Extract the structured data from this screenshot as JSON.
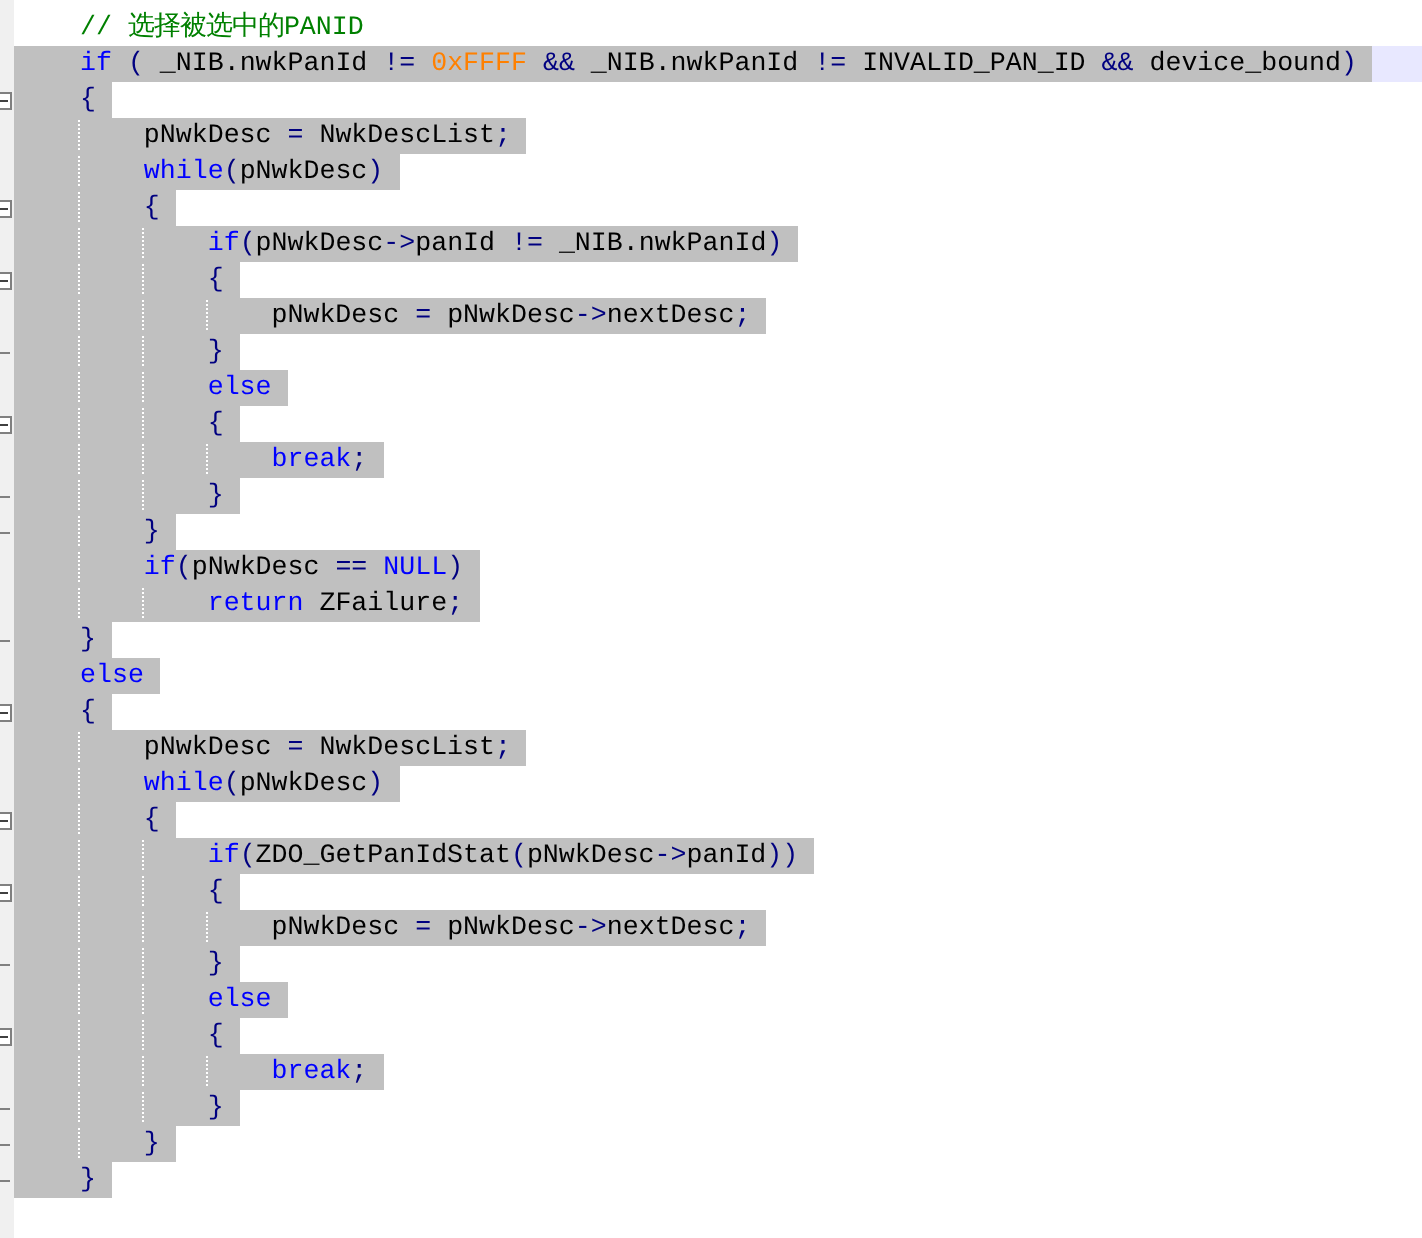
{
  "editor": {
    "lines": [
      {
        "kind": "plain",
        "selected": false,
        "current": false,
        "tokens": [
          {
            "comment": "// 选择被选中的PANID"
          }
        ]
      },
      {
        "kind": "plain",
        "selected": true,
        "current": true,
        "tokens": [
          {
            "keyword": "if"
          },
          {
            "operator": " ( "
          },
          {
            "identifier": "_NIB.nwkPanId "
          },
          {
            "operator": "!= "
          },
          {
            "number": "0xFFFF"
          },
          {
            "operator": " && "
          },
          {
            "identifier": "_NIB.nwkPanId "
          },
          {
            "operator": "!= "
          },
          {
            "identifier": "INVALID_PAN_ID "
          },
          {
            "operator": "&& "
          },
          {
            "identifier": "device_bound"
          },
          {
            "operator": ")"
          }
        ]
      },
      {
        "kind": "block-start",
        "selected": true,
        "current": false,
        "tokens": [
          {
            "operator": "{"
          }
        ]
      },
      {
        "kind": "plain",
        "selected": true,
        "current": false,
        "tokens": [
          {
            "identifier": "    pNwkDesc "
          },
          {
            "operator": "= "
          },
          {
            "identifier": "NwkDescList"
          },
          {
            "operator": ";"
          }
        ]
      },
      {
        "kind": "plain",
        "selected": true,
        "current": false,
        "tokens": [
          {
            "keyword": "    while"
          },
          {
            "operator": "("
          },
          {
            "identifier": "pNwkDesc"
          },
          {
            "operator": ")"
          }
        ]
      },
      {
        "kind": "block-start",
        "selected": true,
        "current": false,
        "tokens": [
          {
            "operator": "    {"
          }
        ]
      },
      {
        "kind": "plain",
        "selected": true,
        "current": false,
        "tokens": [
          {
            "keyword": "        if"
          },
          {
            "operator": "("
          },
          {
            "identifier": "pNwkDesc"
          },
          {
            "operator": "->"
          },
          {
            "identifier": "panId "
          },
          {
            "operator": "!= "
          },
          {
            "identifier": "_NIB.nwkPanId"
          },
          {
            "operator": ")"
          }
        ]
      },
      {
        "kind": "block-start",
        "selected": true,
        "current": false,
        "tokens": [
          {
            "operator": "        {"
          }
        ]
      },
      {
        "kind": "plain",
        "selected": true,
        "current": false,
        "tokens": [
          {
            "identifier": "            pNwkDesc "
          },
          {
            "operator": "= "
          },
          {
            "identifier": "pNwkDesc"
          },
          {
            "operator": "->"
          },
          {
            "identifier": "nextDesc"
          },
          {
            "operator": ";"
          }
        ]
      },
      {
        "kind": "block-end",
        "selected": true,
        "current": false,
        "tokens": [
          {
            "operator": "        }"
          }
        ]
      },
      {
        "kind": "plain",
        "selected": true,
        "current": false,
        "tokens": [
          {
            "keyword": "        else"
          }
        ]
      },
      {
        "kind": "block-start",
        "selected": true,
        "current": false,
        "tokens": [
          {
            "operator": "        {"
          }
        ]
      },
      {
        "kind": "plain",
        "selected": true,
        "current": false,
        "tokens": [
          {
            "keyword": "            break"
          },
          {
            "operator": ";"
          }
        ]
      },
      {
        "kind": "block-end",
        "selected": true,
        "current": false,
        "tokens": [
          {
            "operator": "        }"
          }
        ]
      },
      {
        "kind": "block-end",
        "selected": true,
        "current": false,
        "tokens": [
          {
            "operator": "    }"
          }
        ]
      },
      {
        "kind": "plain",
        "selected": true,
        "current": false,
        "tokens": [
          {
            "keyword": "    if"
          },
          {
            "operator": "("
          },
          {
            "identifier": "pNwkDesc "
          },
          {
            "operator": "== "
          },
          {
            "keyword": "NULL"
          },
          {
            "operator": ")"
          }
        ]
      },
      {
        "kind": "plain",
        "selected": true,
        "current": false,
        "tokens": [
          {
            "keyword": "        return"
          },
          {
            "identifier": " ZFailure"
          },
          {
            "operator": ";"
          }
        ]
      },
      {
        "kind": "block-end",
        "selected": true,
        "current": false,
        "tokens": [
          {
            "operator": "}"
          }
        ]
      },
      {
        "kind": "plain",
        "selected": true,
        "current": false,
        "tokens": [
          {
            "keyword": "else"
          }
        ]
      },
      {
        "kind": "block-start",
        "selected": true,
        "current": false,
        "tokens": [
          {
            "operator": "{"
          }
        ]
      },
      {
        "kind": "plain",
        "selected": true,
        "current": false,
        "tokens": [
          {
            "identifier": "    pNwkDesc "
          },
          {
            "operator": "= "
          },
          {
            "identifier": "NwkDescList"
          },
          {
            "operator": ";"
          }
        ]
      },
      {
        "kind": "plain",
        "selected": true,
        "current": false,
        "tokens": [
          {
            "keyword": "    while"
          },
          {
            "operator": "("
          },
          {
            "identifier": "pNwkDesc"
          },
          {
            "operator": ")"
          }
        ]
      },
      {
        "kind": "block-start",
        "selected": true,
        "current": false,
        "tokens": [
          {
            "operator": "    {"
          }
        ]
      },
      {
        "kind": "plain",
        "selected": true,
        "current": false,
        "tokens": [
          {
            "keyword": "        if"
          },
          {
            "operator": "("
          },
          {
            "identifier": "ZDO_GetPanIdStat"
          },
          {
            "operator": "("
          },
          {
            "identifier": "pNwkDesc"
          },
          {
            "operator": "->"
          },
          {
            "identifier": "panId"
          },
          {
            "operator": "))"
          }
        ]
      },
      {
        "kind": "block-start",
        "selected": true,
        "current": false,
        "tokens": [
          {
            "operator": "        {"
          }
        ]
      },
      {
        "kind": "plain",
        "selected": true,
        "current": false,
        "tokens": [
          {
            "identifier": "            pNwkDesc "
          },
          {
            "operator": "= "
          },
          {
            "identifier": "pNwkDesc"
          },
          {
            "operator": "->"
          },
          {
            "identifier": "nextDesc"
          },
          {
            "operator": ";"
          }
        ]
      },
      {
        "kind": "block-end",
        "selected": true,
        "current": false,
        "tokens": [
          {
            "operator": "        }"
          }
        ]
      },
      {
        "kind": "plain",
        "selected": true,
        "current": false,
        "tokens": [
          {
            "keyword": "        else"
          }
        ]
      },
      {
        "kind": "block-start",
        "selected": true,
        "current": false,
        "tokens": [
          {
            "operator": "        {"
          }
        ]
      },
      {
        "kind": "plain",
        "selected": true,
        "current": false,
        "tokens": [
          {
            "keyword": "            break"
          },
          {
            "operator": ";"
          }
        ]
      },
      {
        "kind": "block-end",
        "selected": true,
        "current": false,
        "tokens": [
          {
            "operator": "        }"
          }
        ]
      },
      {
        "kind": "block-end",
        "selected": true,
        "current": false,
        "tokens": [
          {
            "operator": "    }"
          }
        ]
      },
      {
        "kind": "block-end",
        "selected": true,
        "current": false,
        "tokens": [
          {
            "operator": "}"
          }
        ]
      }
    ]
  }
}
